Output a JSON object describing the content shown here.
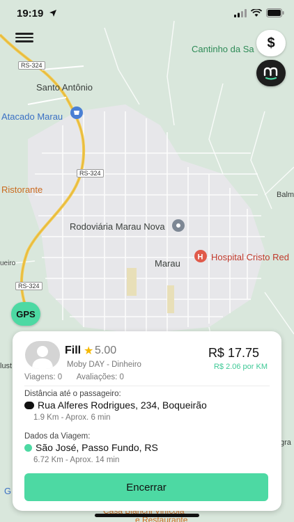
{
  "status_bar": {
    "time": "19:19"
  },
  "map": {
    "labels": {
      "cantinho": "Cantinho da Sa",
      "santo_antonio": "Santo Antônio",
      "atacado": "Atacado Marau",
      "ristorante": "Ristorante",
      "rodoviaria": "Rodoviária Marau Nova",
      "marau": "Marau",
      "hospital": "Hospital Cristo Red",
      "balm": "Balm",
      "eiro": "ueiro",
      "ust": "lust",
      "gra": "gra",
      "casa": "Casa Bianchi Vinícola",
      "restaurante": "e Restaurante",
      "g": "G"
    },
    "roads": {
      "rs324_top": "RS-324",
      "rs324_mid": "RS-324",
      "rs324_bottom": "RS-324"
    }
  },
  "buttons": {
    "dollar": "$",
    "gps": "GPS",
    "end": "Encerrar"
  },
  "card": {
    "driver_name": "Fill",
    "rating": "5.00",
    "service": "Moby DAY - Dinheiro",
    "price": "R$ 17.75",
    "price_per_km": "R$ 2.06 por KM",
    "trips": "Viagens: 0",
    "reviews": "Avaliações: 0",
    "distance_title": "Distância até o passageiro:",
    "pickup_address": "Rua Alferes Rodrigues, 234, Boqueirão",
    "pickup_detail": "1.9 Km - Aprox. 6 min",
    "trip_title": "Dados da Viagem:",
    "destination": "São José, Passo Fundo, RS",
    "trip_detail": "6.72 Km - Aprox. 14 min"
  },
  "colors": {
    "accent": "#4dd9a3",
    "map_green": "#d9e7dc",
    "road_yellow": "#f2c94c",
    "star": "#f5b800"
  }
}
